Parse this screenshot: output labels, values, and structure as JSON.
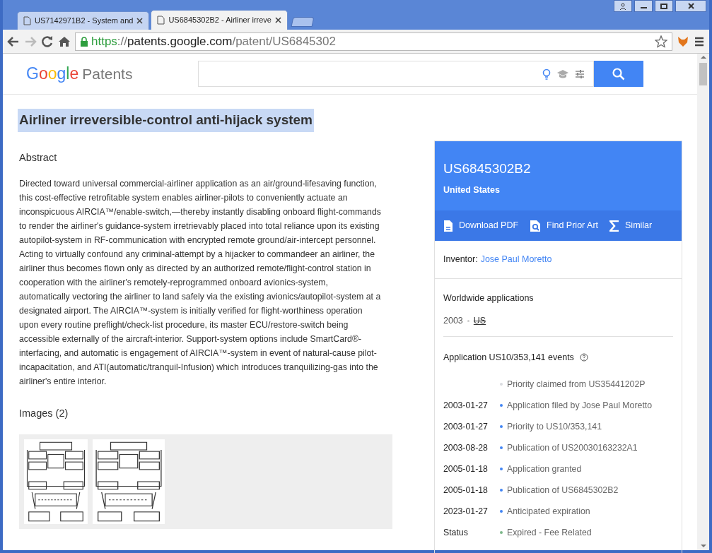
{
  "browser": {
    "tabs": [
      {
        "title": "US7142971B2 - System and",
        "selected": false
      },
      {
        "title": "US6845302B2 - Airliner irreve",
        "selected": true
      }
    ],
    "address": {
      "scheme": "https",
      "separator": "://",
      "host": "patents.google.com",
      "path": "/patent/US6845302",
      "secure": true
    }
  },
  "header": {
    "logo": {
      "brand": "Google",
      "product": "Patents"
    }
  },
  "patent": {
    "title": "Airliner irreversible-control anti-hijack system",
    "title_highlighted": true,
    "abstract_heading": "Abstract",
    "abstract": "Directed toward universal commercial-airliner application as an air/ground-lifesaving function, this cost-effective retrofitable system enables airliner-pilots to conveniently actuate an inconspicuous AIRCIA™/enable-switch,—thereby instantly disabling onboard flight-commands to render the airliner's guidance-system irretrievably placed into total reliance upon its existing autopilot-system in RF-communication with encrypted remote ground/air-intercept personnel. Acting to virtually confound any criminal-attempt by a hijacker to commandeer an airliner, the airliner thus becomes flown only as directed by an authorized remote/flight-control station in cooperation with the airliner's remotely-reprogrammed onboard avionics-system, automatically vectoring the airliner to land safely via the existing avionics/autopilot-system at a designated airport. The AIRCIA™-system is initially verified for flight-worthiness operation upon every routine preflight/check-list procedure, its master ECU/restore-switch being accessible externally of the aircraft-interior. Support-system options include SmartCard®-interfacing, and automatic is engagement of AIRCIA™-system in event of natural-cause pilot-incapacitation, and ATI(automatic/tranquil-Infusion) which introduces tranquilizing-gas into the airliner's entire interior.",
    "images_heading": "Images (2)",
    "images": [
      {
        "kind": "drawing"
      },
      {
        "kind": "drawing"
      }
    ]
  },
  "card": {
    "number": "US6845302B2",
    "country": "United States",
    "actions": [
      {
        "kind": "pdf",
        "label": "Download PDF"
      },
      {
        "kind": "prior",
        "label": "Find Prior Art"
      },
      {
        "kind": "similar",
        "label": "Similar"
      }
    ],
    "inventor_label": "Inventor:",
    "inventor": "Jose Paul Moretto",
    "worldwide_heading": "Worldwide applications",
    "worldwide": [
      {
        "year": "2003",
        "country": "US",
        "struck": true
      }
    ],
    "events_heading": "Application US10/353,141 events",
    "events": [
      {
        "text": "Priority claimed from US35441202P",
        "color": "#dadce0"
      },
      {
        "date": "2003-01-27",
        "text": "Application filed by Jose Paul Moretto",
        "color": "#4285f4"
      },
      {
        "date": "2003-01-27",
        "text": "Priority to US10/353,141",
        "color": "#4285f4"
      },
      {
        "date": "2003-08-28",
        "text": "Publication of US20030163232A1",
        "color": "#4285f4"
      },
      {
        "date": "2005-01-18",
        "text": "Application granted",
        "color": "#4285f4"
      },
      {
        "date": "2005-01-18",
        "text": "Publication of US6845302B2",
        "color": "#4285f4"
      },
      {
        "date": "2023-01-27",
        "text": "Anticipated expiration",
        "color": "#4285f4"
      },
      {
        "date": "Status",
        "text": "Expired - Fee Related",
        "color": "#7cb88a"
      }
    ]
  }
}
